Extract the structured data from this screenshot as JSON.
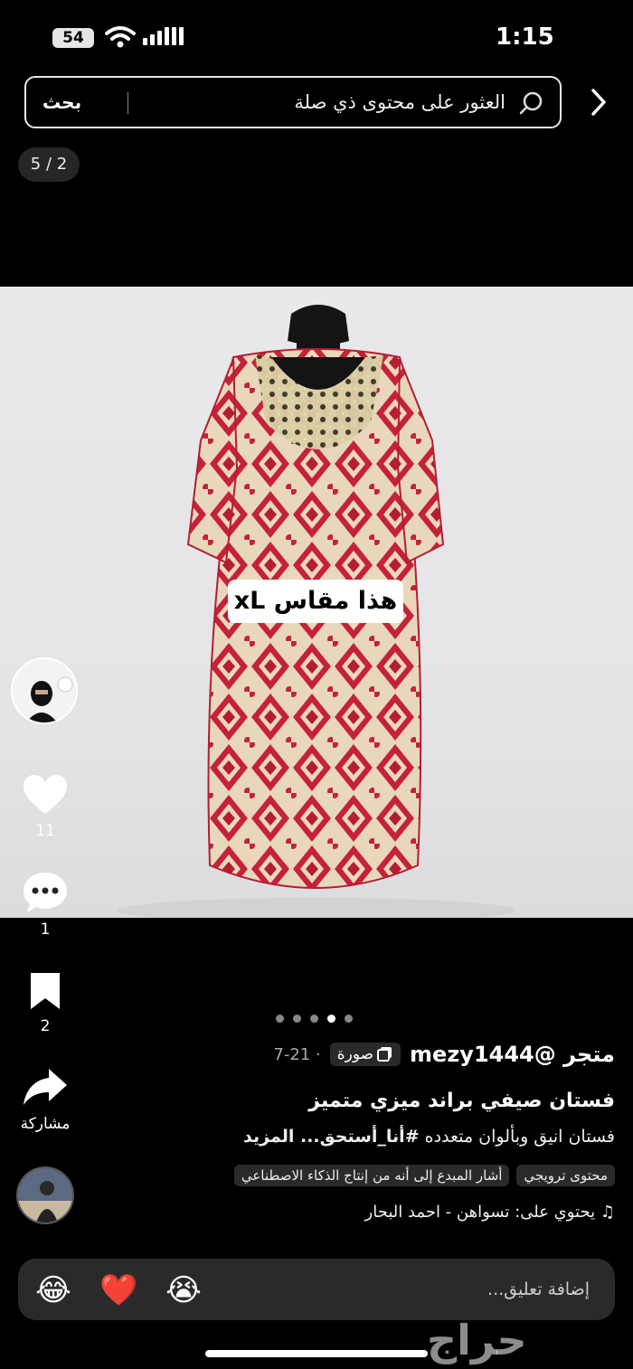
{
  "status": {
    "battery": "54",
    "time": "1:15"
  },
  "search": {
    "placeholder": "العثور على محتوى ذي صلة",
    "button": "بحث"
  },
  "counter": "5 / 2",
  "photo": {
    "size_tag": "هذا مقاس xL"
  },
  "actions": {
    "likes": "11",
    "comments": "1",
    "saves": "2",
    "share_label": "مشاركة"
  },
  "post": {
    "username": "متجر @mezy1444",
    "type_label": "صورة",
    "date": "7-21",
    "title": "فستان صيفي براند ميزي متميز",
    "description": "فستان انيق وبألوان متعدده ",
    "hashtag": "#أنا_أستحق",
    "more": "... المزيد",
    "tags": [
      "محتوى ترويجي",
      "أشار المبدع إلى أنه من إنتاج الذكاء الاصطناعي"
    ],
    "music": "يحتوي على: تسواهن - احمد البحار"
  },
  "comment": {
    "placeholder": "إضافة تعليق...",
    "emojis": [
      "😂",
      "❤️",
      "😭"
    ]
  },
  "watermark": "حراج",
  "colors": {
    "dress_red": "#c8243a",
    "dress_cream": "#ead9bf",
    "background": "#000000"
  }
}
